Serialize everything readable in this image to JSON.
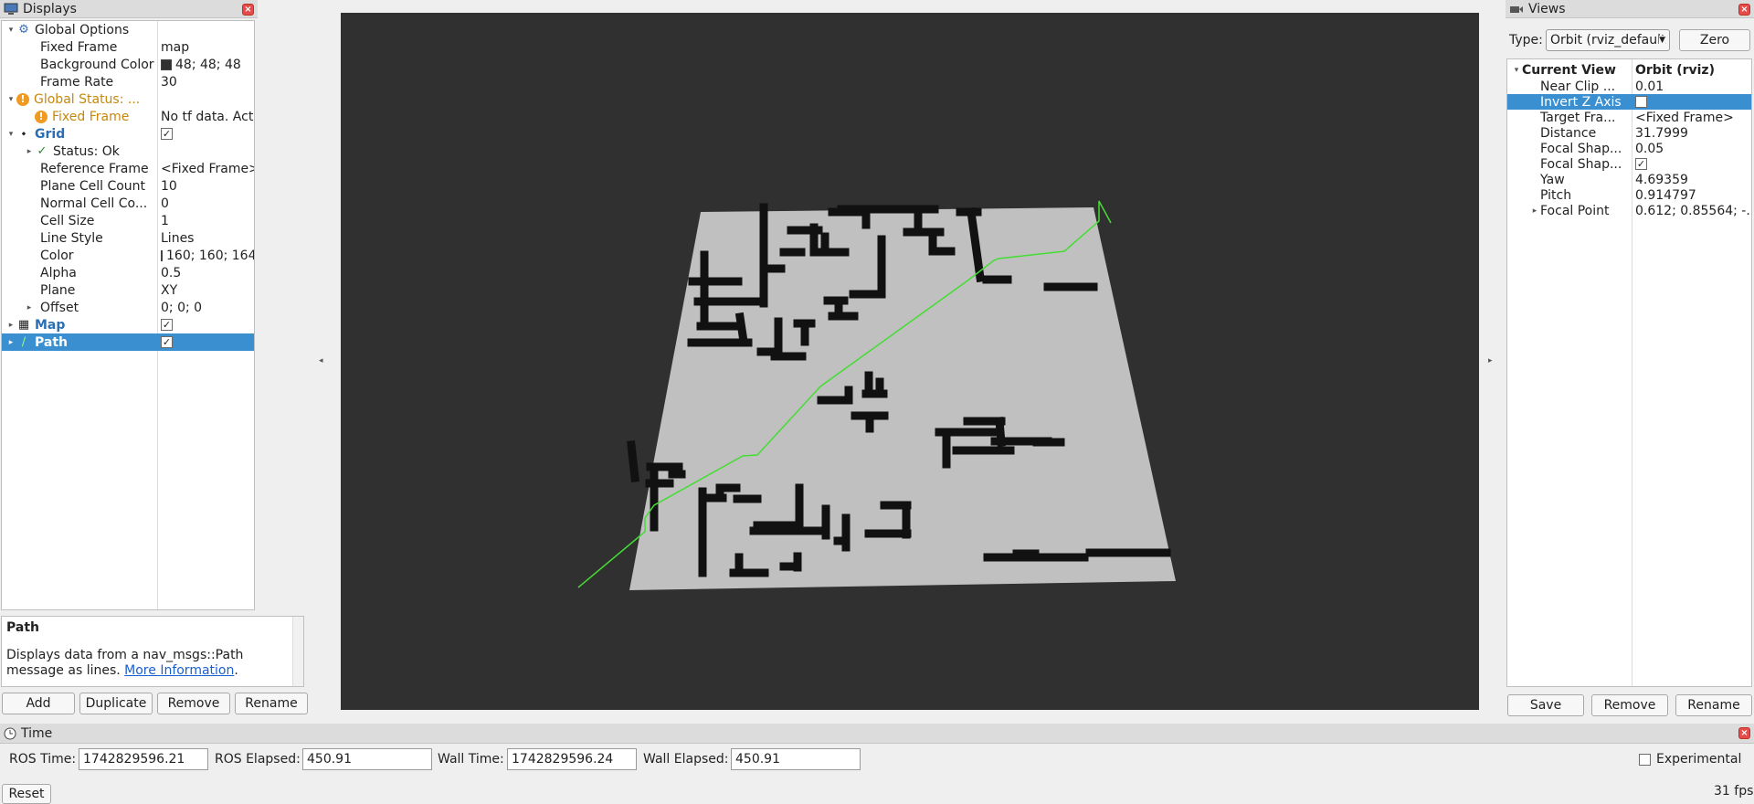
{
  "displays": {
    "title": "Displays",
    "rows": [
      {
        "name": "Global Options",
        "value": "",
        "level": 0,
        "arrow": "▾",
        "icon": "gear-icon",
        "kind": "normal"
      },
      {
        "name": "Fixed Frame",
        "value": "map",
        "level": 1,
        "arrow": "",
        "kind": "normal"
      },
      {
        "name": "Background Color",
        "value": "48; 48; 48",
        "level": 1,
        "arrow": "",
        "kind": "color",
        "color": "#303030"
      },
      {
        "name": "Frame Rate",
        "value": "30",
        "level": 1,
        "arrow": "",
        "kind": "normal"
      },
      {
        "name": "Global Status: ...",
        "value": "",
        "level": 0,
        "arrow": "▾",
        "icon": "warning-icon",
        "kind": "warn"
      },
      {
        "name": "Fixed Frame",
        "value": "No tf data.  Actual err...",
        "level": 1,
        "arrow": "",
        "icon": "warning-icon",
        "kind": "warn"
      },
      {
        "name": "Grid",
        "value": "",
        "level": 0,
        "arrow": "▾",
        "icon": "grid-icon",
        "kind": "blue",
        "checked": true
      },
      {
        "name": "Status: Ok",
        "value": "",
        "level": 1,
        "arrow": "▸",
        "icon": "checkmark-icon",
        "kind": "normal"
      },
      {
        "name": "Reference Frame",
        "value": "<Fixed Frame>",
        "level": 1,
        "arrow": "",
        "kind": "normal"
      },
      {
        "name": "Plane Cell Count",
        "value": "10",
        "level": 1,
        "arrow": "",
        "kind": "normal"
      },
      {
        "name": "Normal Cell Co...",
        "value": "0",
        "level": 1,
        "arrow": "",
        "kind": "normal"
      },
      {
        "name": "Cell Size",
        "value": "1",
        "level": 1,
        "arrow": "",
        "kind": "normal"
      },
      {
        "name": "Line Style",
        "value": "Lines",
        "level": 1,
        "arrow": "",
        "kind": "normal"
      },
      {
        "name": "Color",
        "value": "160; 160; 164",
        "level": 1,
        "arrow": "",
        "kind": "color",
        "color": "#a0a0a4"
      },
      {
        "name": "Alpha",
        "value": "0.5",
        "level": 1,
        "arrow": "",
        "kind": "normal"
      },
      {
        "name": "Plane",
        "value": "XY",
        "level": 1,
        "arrow": "",
        "kind": "normal"
      },
      {
        "name": "Offset",
        "value": "0; 0; 0",
        "level": 1,
        "arrow": "▸",
        "kind": "normal"
      },
      {
        "name": "Map",
        "value": "",
        "level": 0,
        "arrow": "▸",
        "icon": "map-icon",
        "kind": "blue",
        "checked": true
      },
      {
        "name": "Path",
        "value": "",
        "level": 0,
        "arrow": "▸",
        "icon": "path-icon",
        "kind": "blue",
        "checked": true,
        "selected": true
      }
    ],
    "help_title": "Path",
    "help_text": "Displays data from a nav_msgs::Path message as lines.",
    "help_link": "More Information",
    "help_end": ".",
    "buttons": {
      "add": "Add",
      "duplicate": "Duplicate",
      "remove": "Remove",
      "rename": "Rename"
    }
  },
  "views": {
    "title": "Views",
    "type_label": "Type:",
    "type_value": "Orbit (rviz_default",
    "zero": "Zero",
    "header": {
      "name": "Current View",
      "value": "Orbit (rviz)"
    },
    "rows": [
      {
        "name": "Near Clip ...",
        "value": "0.01"
      },
      {
        "name": "Invert Z Axis",
        "value": "",
        "check": false,
        "selected": true
      },
      {
        "name": "Target Fra...",
        "value": "<Fixed Frame>"
      },
      {
        "name": "Distance",
        "value": "31.7999"
      },
      {
        "name": "Focal Shap...",
        "value": "0.05"
      },
      {
        "name": "Focal Shap...",
        "value": "",
        "check": true
      },
      {
        "name": "Yaw",
        "value": "4.69359"
      },
      {
        "name": "Pitch",
        "value": "0.914797"
      },
      {
        "name": "Focal Point",
        "value": "0.612; 0.85564; -...",
        "arrow": "▸"
      }
    ],
    "buttons": {
      "save": "Save",
      "remove": "Remove",
      "rename": "Rename"
    }
  },
  "time": {
    "title": "Time",
    "ros_time_label": "ROS Time:",
    "ros_time": "1742829596.21",
    "ros_elapsed_label": "ROS Elapsed:",
    "ros_elapsed": "450.91",
    "wall_time_label": "Wall Time:",
    "wall_time": "1742829596.24",
    "wall_elapsed_label": "Wall Elapsed:",
    "wall_elapsed": "450.91",
    "experimental": "Experimental",
    "reset": "Reset",
    "fps": "31 fps"
  },
  "viewport": {
    "background": "#303030",
    "floor": "#c0c0c0",
    "wall": "#111111",
    "path_color": "#44dd33"
  }
}
